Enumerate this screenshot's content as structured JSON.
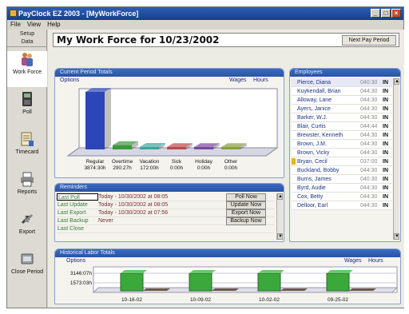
{
  "app": {
    "title": "PayClock EZ 2003 - [MyWorkForce]",
    "window_buttons": [
      "_",
      "□",
      "×"
    ]
  },
  "menu": [
    "File",
    "View",
    "Help"
  ],
  "sidebar": {
    "setup_label": "Setup",
    "data_label": "Data",
    "items": [
      {
        "label": "Work Force",
        "icon": "people-icon"
      },
      {
        "label": "Poll",
        "icon": "time-clock-icon"
      },
      {
        "label": "Timecard",
        "icon": "timecard-icon"
      },
      {
        "label": "Reports",
        "icon": "printer-icon"
      },
      {
        "label": "Export",
        "icon": "export-arrows-icon"
      },
      {
        "label": "Close Period",
        "icon": "close-period-icon"
      }
    ]
  },
  "header": {
    "title": "My Work Force for 10/23/2002",
    "next_pay_period": "Next Pay Period"
  },
  "current_period": {
    "title": "Current Period Totals",
    "options_link": "Options",
    "wages_link": "Wages",
    "hours_link": "Hours",
    "chart_data": {
      "type": "bar",
      "categories": [
        "Regular",
        "Overtime",
        "Vacation",
        "Sick",
        "Holiday",
        "Other"
      ],
      "value_labels": [
        "3874:30h",
        "290:27h",
        "172:00h",
        "0:00h",
        "0:00h",
        "0:00h"
      ],
      "values": [
        3874.5,
        290.45,
        172,
        0,
        0,
        0
      ],
      "colors": [
        "#2b46b8",
        "#3a9a3a",
        "#3aa59a",
        "#b84a4a",
        "#7a4aa0",
        "#8aa03a"
      ],
      "grid": false,
      "legend": "none"
    }
  },
  "reminders": {
    "title": "Reminders",
    "rows": [
      {
        "label": "Last Poll",
        "value": "Today - 10/30/2002 at 08:05",
        "button": "Poll Now"
      },
      {
        "label": "Last Update",
        "value": "Today - 10/30/2002 at 08:05",
        "button": "Update Now"
      },
      {
        "label": "Last Export",
        "value": "Today - 10/30/2002 at 07:56",
        "button": "Export Now"
      },
      {
        "label": "Last Backup",
        "value": "Never",
        "button": "Backup Now"
      },
      {
        "label": "Last Close",
        "value": "",
        "button": ""
      }
    ]
  },
  "employees": {
    "title": "Employees",
    "rows": [
      {
        "name": "Pierce, Diana",
        "hours": "040:30",
        "status": "IN"
      },
      {
        "name": "Kuykendall, Brian",
        "hours": "044:30",
        "status": "IN"
      },
      {
        "name": "Alloway, Lane",
        "hours": "044:30",
        "status": "IN"
      },
      {
        "name": "Ayers, Janice",
        "hours": "044:30",
        "status": "IN"
      },
      {
        "name": "Barker, W.J.",
        "hours": "044:30",
        "status": "IN"
      },
      {
        "name": "Blair, Curtis",
        "hours": "044:44",
        "status": "IN"
      },
      {
        "name": "Brewster, Kenneth",
        "hours": "044:30",
        "status": "IN"
      },
      {
        "name": "Brown, J.M.",
        "hours": "044:30",
        "status": "IN"
      },
      {
        "name": "Brown, Vicky",
        "hours": "044:30",
        "status": "IN"
      },
      {
        "name": "Bryan, Cecil",
        "hours": "037:00",
        "status": "IN"
      },
      {
        "name": "Buckland, Bobby",
        "hours": "044:30",
        "status": "IN"
      },
      {
        "name": "Burns, James",
        "hours": "040:30",
        "status": "IN"
      },
      {
        "name": "Byrd, Audie",
        "hours": "044:30",
        "status": "IN"
      },
      {
        "name": "Cox, Betty",
        "hours": "044:30",
        "status": "IN"
      },
      {
        "name": "Delloor, Earl",
        "hours": "044:30",
        "status": "IN"
      }
    ]
  },
  "historical": {
    "title": "Historical Labor Totals",
    "options_link": "Options",
    "wages_link": "Wages",
    "hours_link": "Hours",
    "chart_data": {
      "type": "bar",
      "categories": [
        "10-16-02",
        "10-09-02",
        "10-02-02",
        "09-25-02"
      ],
      "y_tick_labels": [
        "3146:07h",
        "1573:03h"
      ],
      "series": [
        {
          "values": [
            3146.1,
            3146.1,
            3146.1,
            3146.1
          ],
          "color": "#3aa83a"
        },
        {
          "values": [
            0,
            0,
            0,
            0
          ],
          "color": "#6a5a4a"
        }
      ],
      "ylim": [
        0,
        3146.1
      ],
      "grid": true
    }
  }
}
